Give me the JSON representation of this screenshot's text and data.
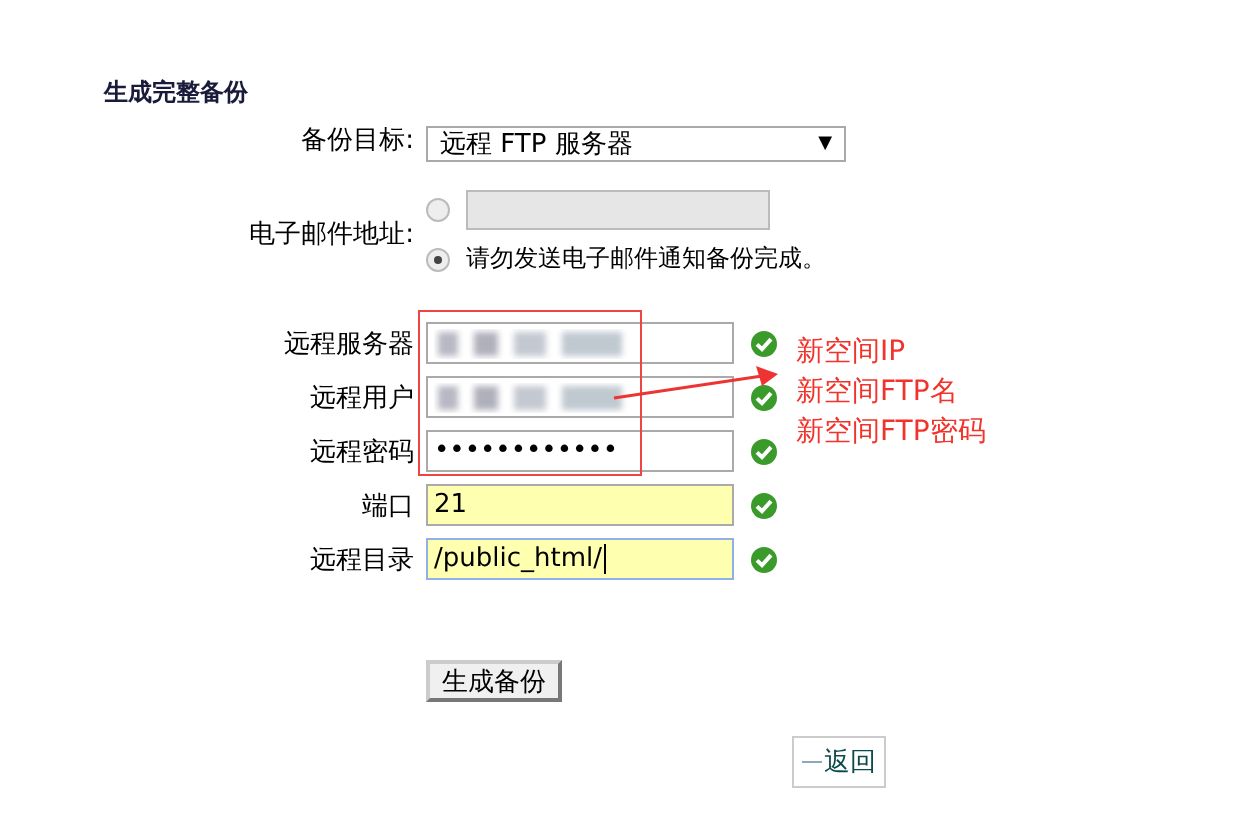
{
  "title": "生成完整备份",
  "backup_target": {
    "label": "备份目标:",
    "value": "远程 FTP 服务器",
    "caret": "▼"
  },
  "email": {
    "label": "电子邮件地址:",
    "options": [
      {
        "kind": "field",
        "selected": false
      },
      {
        "kind": "text",
        "label": "请勿发送电子邮件通知备份完成。",
        "selected": true
      }
    ]
  },
  "ftp_fields": [
    {
      "label": "远程服务器",
      "kind": "blurred",
      "highlighted": false,
      "focused": false,
      "valid": true
    },
    {
      "label": "远程用户",
      "kind": "blurred",
      "highlighted": false,
      "focused": false,
      "valid": true
    },
    {
      "label": "远程密码",
      "kind": "text",
      "value": "••••••••••••",
      "highlighted": false,
      "focused": false,
      "valid": true
    },
    {
      "label": "端口",
      "kind": "text",
      "value": "21",
      "highlighted": true,
      "focused": false,
      "valid": true
    },
    {
      "label": "远程目录",
      "kind": "text",
      "value": "/public_html/",
      "highlighted": true,
      "focused": true,
      "valid": true
    }
  ],
  "button": "生成备份",
  "back_link": "返回",
  "annotation_notes": [
    "新空间IP",
    "新空间FTP名",
    "新空间FTP密码"
  ]
}
